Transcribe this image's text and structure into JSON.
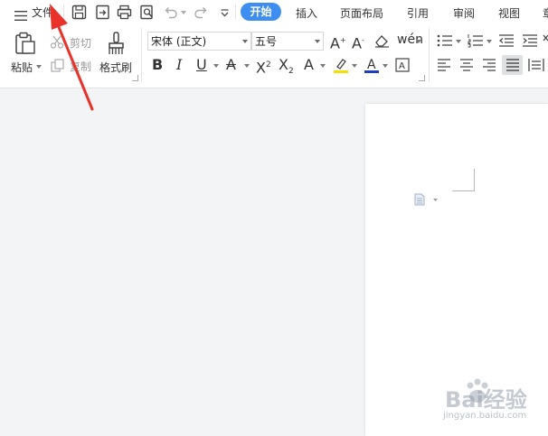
{
  "titlebar": {
    "menu_label": "文件",
    "tabs": [
      {
        "label": "开始",
        "active": true
      },
      {
        "label": "插入"
      },
      {
        "label": "页面布局"
      },
      {
        "label": "引用"
      },
      {
        "label": "审阅"
      },
      {
        "label": "视图"
      },
      {
        "label": "章"
      }
    ],
    "quick_icons": [
      "save-icon",
      "export-pdf-icon",
      "print-icon",
      "print-preview-icon",
      "undo-icon",
      "redo-icon",
      "customize-icon"
    ]
  },
  "ribbon": {
    "paste_label": "粘贴",
    "cut_label": "剪切",
    "copy_label": "复制",
    "format_painter_label": "格式刷",
    "font_name": "宋体 (正文)",
    "font_size": "五号",
    "accent_color": "#3d8ef0",
    "highlight_color": "#f5e100",
    "font_color": "#1e3fbf"
  },
  "watermark": {
    "brand": "Bai经验",
    "url": "jingyan.baidu.com"
  }
}
